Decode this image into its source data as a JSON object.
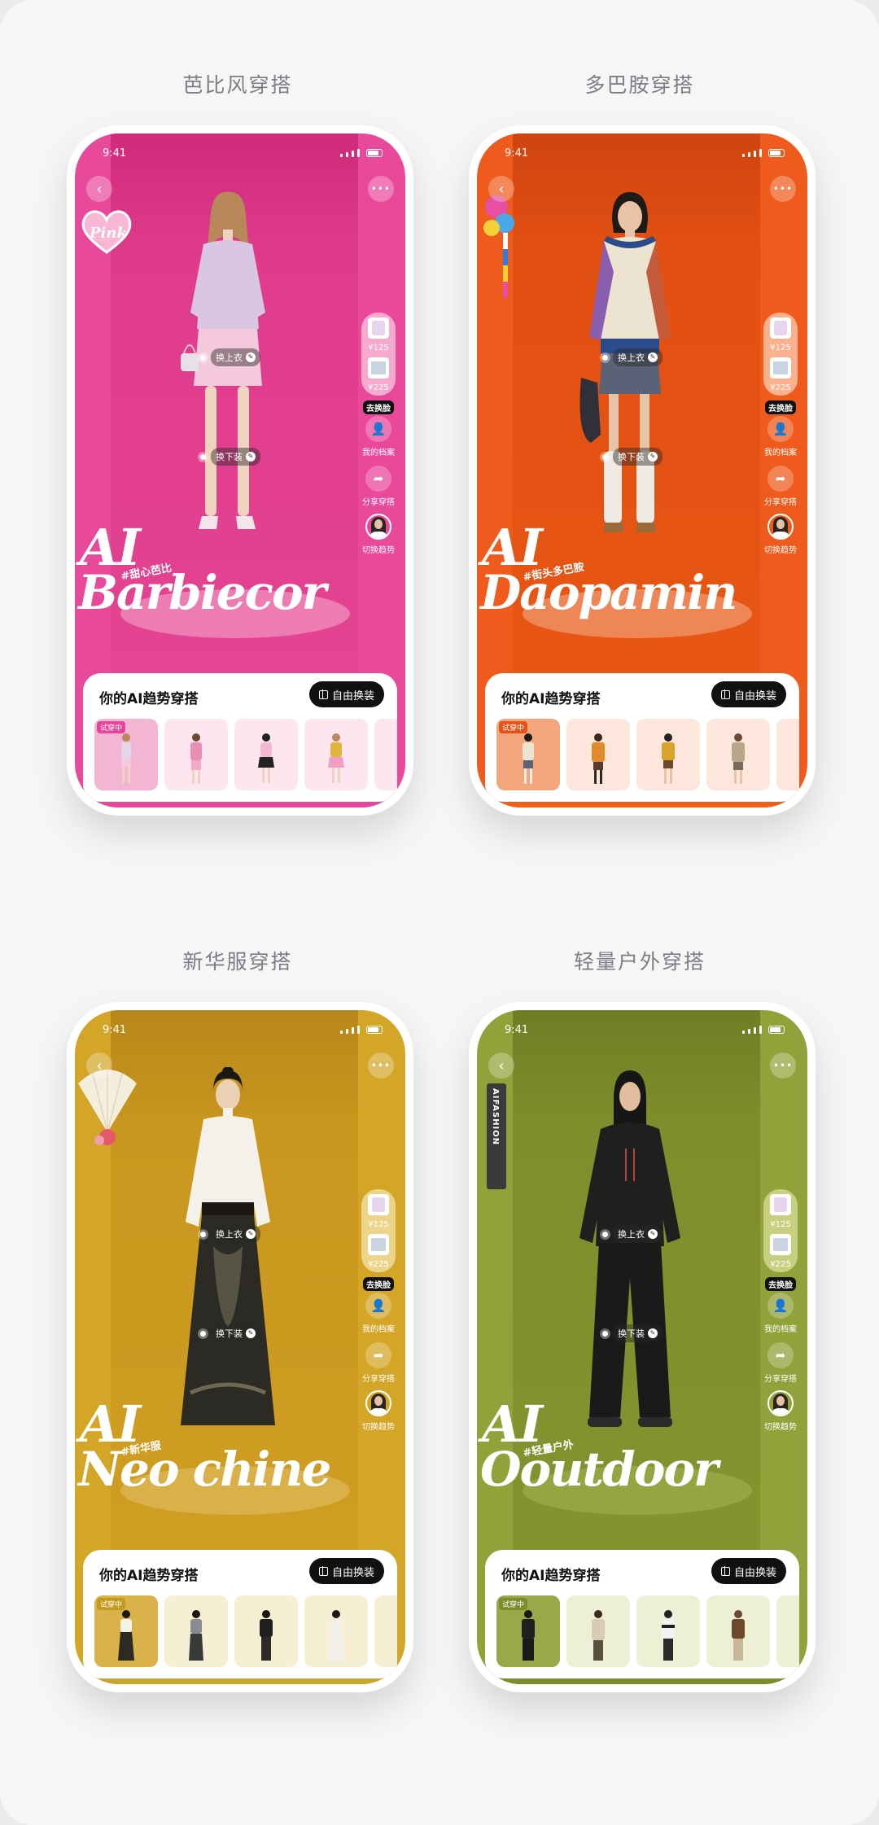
{
  "phones": [
    {
      "key": "barbie",
      "caption": "芭比风穿搭",
      "time": "9:41",
      "hotspot_top": "换上衣",
      "hotspot_bottom": "换下装",
      "top_price": "¥125",
      "bottom_price": "¥225",
      "go_try_label": "去换脸",
      "profile_label": "我的档案",
      "share_label": "分享穿搭",
      "switch_label": "切换趋势",
      "big_ai": "AI",
      "big_word": "Barbiecor",
      "hashtag": "#甜心芭比",
      "panel_title": "你的AI趋势穿搭",
      "panel_button": "自由换装",
      "trying_label": "试穿中",
      "colors": {
        "bg": "#e9499b",
        "alcove": "#e03a8c",
        "band": "#e6459b",
        "accent": "#f7a9d0",
        "floor": "#f8c3dd",
        "panel_bg": "#fde6f0"
      }
    },
    {
      "key": "dopamine",
      "caption": "多巴胺穿搭",
      "time": "9:41",
      "hotspot_top": "换上衣",
      "hotspot_bottom": "换下装",
      "top_price": "¥125",
      "bottom_price": "¥225",
      "go_try_label": "去换脸",
      "profile_label": "我的档案",
      "share_label": "分享穿搭",
      "switch_label": "切换趋势",
      "big_ai": "AI",
      "big_word": "Daopamin",
      "hashtag": "#街头多巴胺",
      "panel_title": "你的AI趋势穿搭",
      "panel_button": "自由换装",
      "trying_label": "试穿中",
      "colors": {
        "bg": "#ef5b1c",
        "alcove": "#e24f12",
        "band": "#f15e18",
        "accent": "#fbb18e",
        "floor": "#f9c3a6",
        "panel_bg": "#fde7dc"
      }
    },
    {
      "key": "neochinese",
      "caption": "新华服穿搭",
      "time": "9:41",
      "hotspot_top": "换上衣",
      "hotspot_bottom": "换下装",
      "top_price": "¥125",
      "bottom_price": "¥225",
      "go_try_label": "去换脸",
      "profile_label": "我的档案",
      "share_label": "分享穿搭",
      "switch_label": "切换趋势",
      "big_ai": "AI",
      "big_word": "Neo chine",
      "hashtag": "#新华服",
      "panel_title": "你的AI趋势穿搭",
      "panel_button": "自由换装",
      "trying_label": "试穿中",
      "colors": {
        "bg": "#d4a628",
        "alcove": "#c9971d",
        "band": "#c9a52b",
        "accent": "#ecd58a",
        "floor": "#e8c97a",
        "panel_bg": "#f7efd3"
      }
    },
    {
      "key": "outdoor",
      "caption": "轻量户外穿搭",
      "time": "9:41",
      "hotspot_top": "换上衣",
      "hotspot_bottom": "换下装",
      "top_price": "¥125",
      "bottom_price": "¥225",
      "go_try_label": "去换脸",
      "profile_label": "我的档案",
      "share_label": "分享穿搭",
      "switch_label": "切换趋势",
      "big_ai": "AI",
      "big_word": "Ooutdoor",
      "hashtag": "#轻量户外",
      "panel_title": "你的AI趋势穿搭",
      "panel_button": "自由换装",
      "trying_label": "试穿中",
      "side_tag": "AIFASHION",
      "colors": {
        "bg": "#93a13a",
        "alcove": "#7f8e2c",
        "band": "#7c8b2b",
        "accent": "#c6d07e",
        "floor": "#aebc5c",
        "panel_bg": "#eef0d6"
      }
    }
  ]
}
